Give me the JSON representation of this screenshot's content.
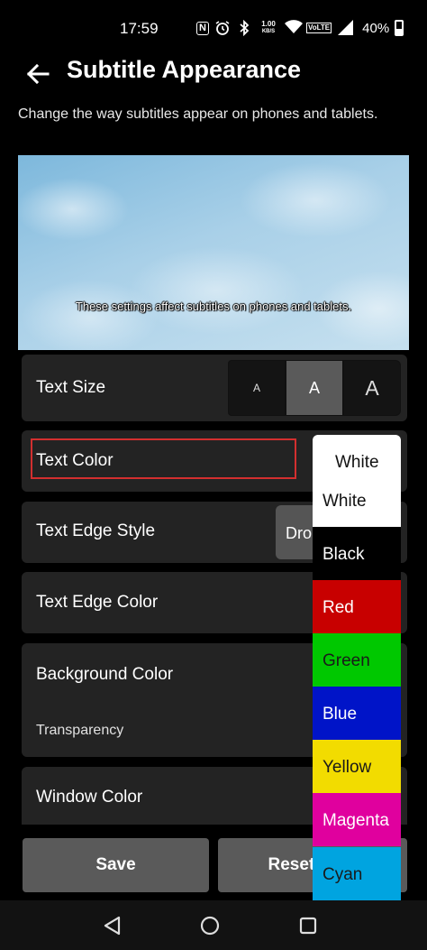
{
  "status_bar": {
    "time": "17:59",
    "nfc_icon": "N",
    "net_speed_value": "1.00",
    "net_speed_unit": "KB/S",
    "volte_badge": "VoLTE",
    "battery_percent": "40%"
  },
  "header": {
    "title": "Subtitle Appearance",
    "description": "Change the way subtitles appear on phones and tablets."
  },
  "preview": {
    "caption": "These settings affect subtitles on phones and tablets."
  },
  "settings": {
    "text_size": {
      "label": "Text Size",
      "options": [
        "A",
        "A",
        "A"
      ],
      "selected_index": 1
    },
    "text_color": {
      "label": "Text Color"
    },
    "text_edge_style": {
      "label": "Text Edge Style",
      "value": "Drop"
    },
    "text_edge_color": {
      "label": "Text Edge Color"
    },
    "background_color": {
      "label": "Background Color",
      "transparency_label": "Transparency"
    },
    "window_color": {
      "label": "Window Color"
    }
  },
  "color_dropdown": {
    "selected": "White",
    "options": [
      {
        "label": "White",
        "bg": "#ffffff",
        "fg": "#111111"
      },
      {
        "label": "Black",
        "bg": "#000000",
        "fg": "#ffffff"
      },
      {
        "label": "Red",
        "bg": "#c80000",
        "fg": "#ffffff"
      },
      {
        "label": "Green",
        "bg": "#00c800",
        "fg": "#1a1a1a"
      },
      {
        "label": "Blue",
        "bg": "#0014c8",
        "fg": "#ffffff"
      },
      {
        "label": "Yellow",
        "bg": "#f2dc00",
        "fg": "#1a1a1a"
      },
      {
        "label": "Magenta",
        "bg": "#e0009e",
        "fg": "#ffffff"
      },
      {
        "label": "Cyan",
        "bg": "#00a4e0",
        "fg": "#1a1a1a"
      }
    ]
  },
  "actions": {
    "save_label": "Save",
    "reset_label": "Reset to"
  },
  "colors": {
    "background": "#000000",
    "row_bg": "#232323",
    "button_bg": "#5a5a5a",
    "highlight": "#d32f2f"
  }
}
